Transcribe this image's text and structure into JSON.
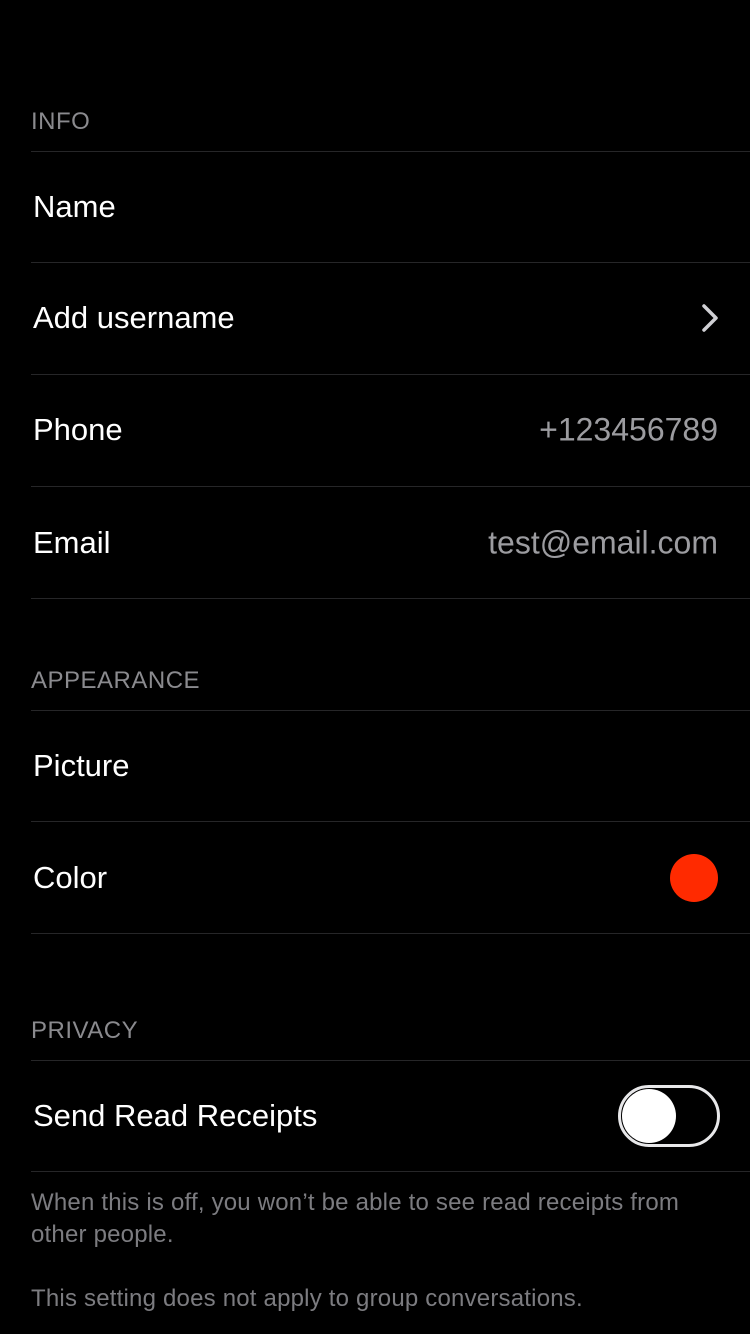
{
  "sections": {
    "info": {
      "header": "INFO",
      "rows": {
        "name": {
          "label": "Name"
        },
        "username": {
          "label": "Add username"
        },
        "phone": {
          "label": "Phone",
          "value": "+123456789"
        },
        "email": {
          "label": "Email",
          "value": "test@email.com"
        }
      }
    },
    "appearance": {
      "header": "APPEARANCE",
      "rows": {
        "picture": {
          "label": "Picture"
        },
        "color": {
          "label": "Color",
          "swatch": "#ff2a00"
        }
      }
    },
    "privacy": {
      "header": "PRIVACY",
      "rows": {
        "read_receipts": {
          "label": "Send Read Receipts",
          "enabled": false
        }
      },
      "footnotes": [
        "When this is off, you won’t be able to see read receipts from other people.",
        "This setting does not apply to group conversations."
      ]
    }
  },
  "icons": {
    "chevron": "chevron-right-icon"
  }
}
